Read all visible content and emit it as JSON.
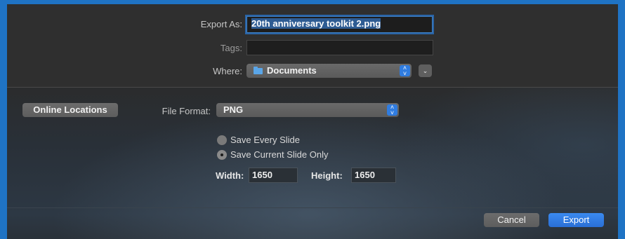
{
  "dialog": {
    "export_as_label": "Export As:",
    "export_as_value": "20th anniversary toolkit 2.png",
    "tags_label": "Tags:",
    "tags_value": "",
    "where_label": "Where:",
    "where_value": "Documents",
    "where_icon": "folder-icon",
    "expand_icon": "chevron-down-icon"
  },
  "options": {
    "online_locations_label": "Online Locations",
    "file_format_label": "File Format:",
    "file_format_value": "PNG",
    "radio_every_label": "Save Every Slide",
    "radio_current_label": "Save Current Slide Only",
    "selected_radio": "current",
    "width_label": "Width:",
    "width_value": "1650",
    "height_label": "Height:",
    "height_value": "1650"
  },
  "footer": {
    "cancel_label": "Cancel",
    "export_label": "Export"
  },
  "colors": {
    "accent": "#2f7ce0",
    "window_border": "#1f73c4"
  }
}
